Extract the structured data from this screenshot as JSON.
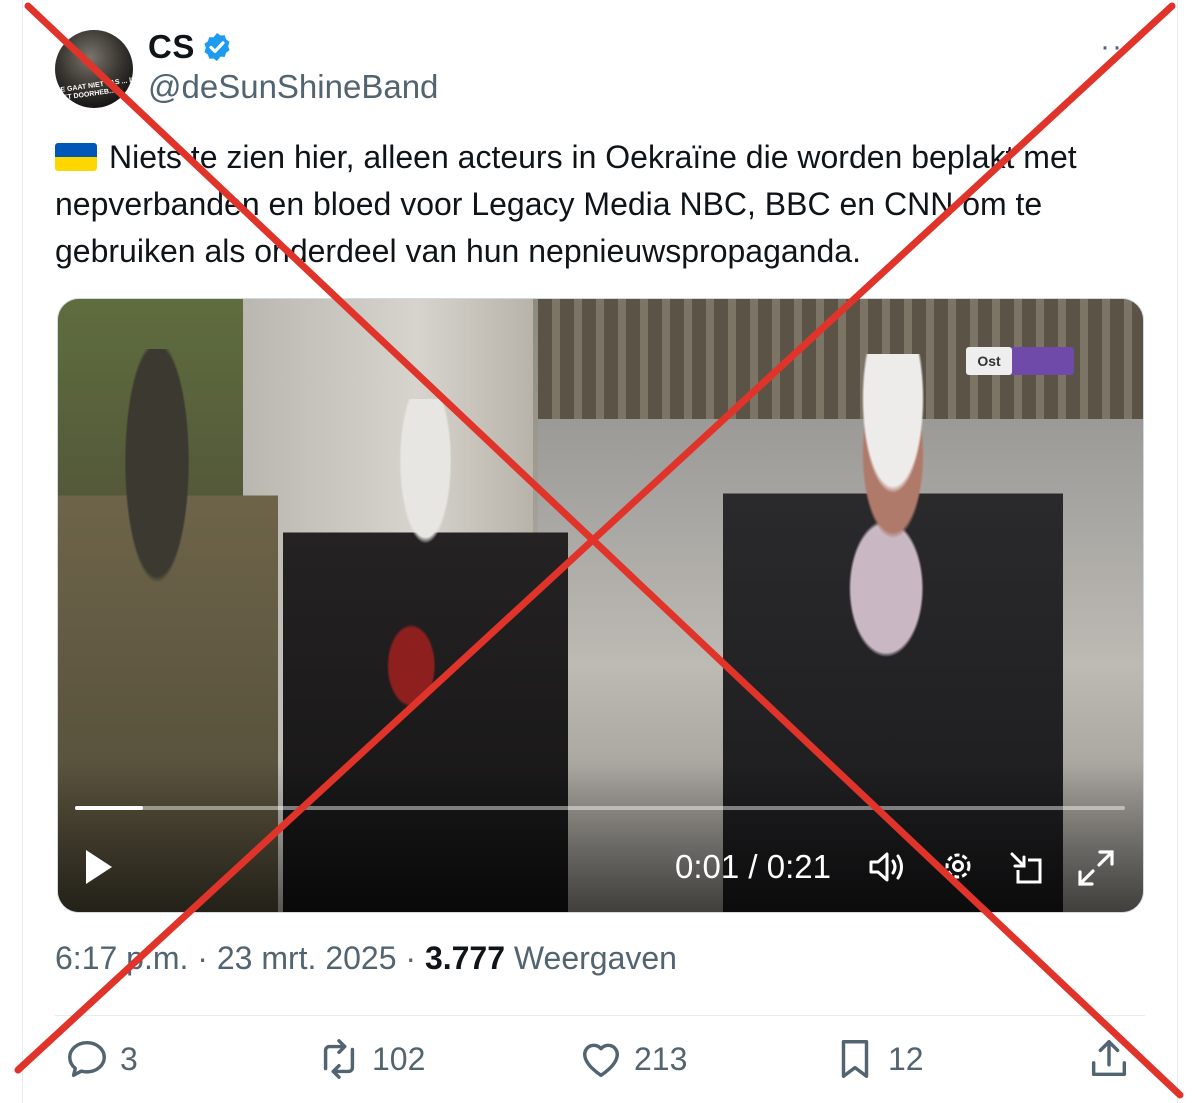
{
  "tweet": {
    "author": {
      "display_name": "CS",
      "handle": "@deSunShineBand",
      "avatar_text": "JE GAAT NIET PAS ... IS HET DOORHEB...",
      "verified": true
    },
    "more_label": "··",
    "flag_icon": "ukraine-flag-icon",
    "text": "Niets te zien hier, alleen acteurs in Oekraïne die worden beplakt met nepverbanden en bloed voor Legacy Media NBC, BBC en CNN om te gebruiken als onderdeel van hun nepnieuwspropaganda.",
    "video": {
      "timecode": "0:01 / 0:21",
      "progress": 0.065,
      "sign_text": "Ost"
    },
    "time": "6:17 p.m.",
    "date": "23 mrt. 2025",
    "views_count": "3.777",
    "views_label": "Weergaven",
    "separator": "·",
    "actions": {
      "replies": "3",
      "reposts": "102",
      "likes": "213",
      "bookmarks": "12"
    }
  },
  "colors": {
    "accent": "#1d9bf0",
    "muted": "#536471",
    "cross": "#e0342b"
  },
  "icons": [
    "verified-badge-icon",
    "more-icon",
    "play-icon",
    "volume-icon",
    "settings-icon",
    "dock-icon",
    "fullscreen-icon",
    "reply-icon",
    "repost-icon",
    "like-icon",
    "bookmark-icon",
    "share-icon"
  ]
}
